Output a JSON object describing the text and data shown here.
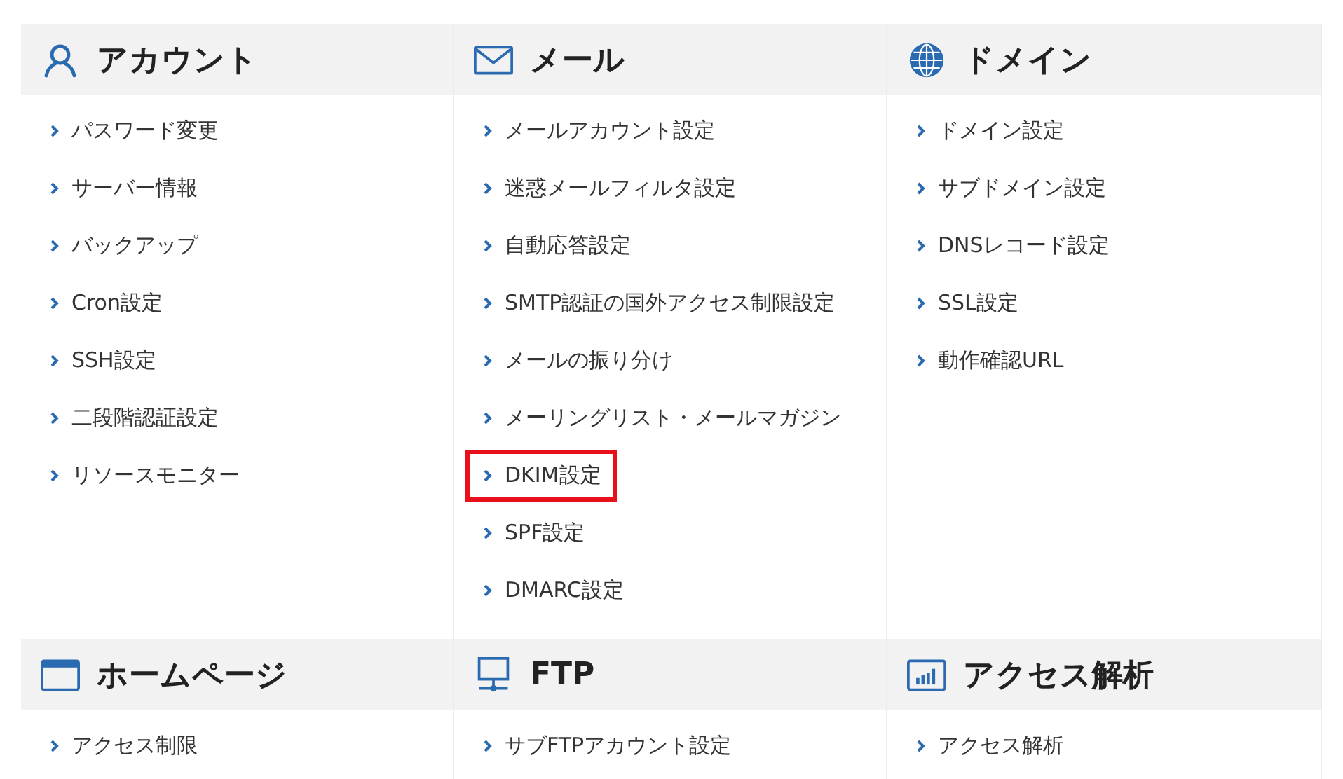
{
  "sections": [
    {
      "title": "アカウント",
      "items": [
        {
          "label": "パスワード変更",
          "highlighted": false
        },
        {
          "label": "サーバー情報",
          "highlighted": false
        },
        {
          "label": "バックアップ",
          "highlighted": false
        },
        {
          "label": "Cron設定",
          "highlighted": false
        },
        {
          "label": "SSH設定",
          "highlighted": false
        },
        {
          "label": "二段階認証設定",
          "highlighted": false
        },
        {
          "label": "リソースモニター",
          "highlighted": false
        }
      ]
    },
    {
      "title": "メール",
      "items": [
        {
          "label": "メールアカウント設定",
          "highlighted": false
        },
        {
          "label": "迷惑メールフィルタ設定",
          "highlighted": false
        },
        {
          "label": "自動応答設定",
          "highlighted": false
        },
        {
          "label": "SMTP認証の国外アクセス制限設定",
          "highlighted": false
        },
        {
          "label": "メールの振り分け",
          "highlighted": false
        },
        {
          "label": "メーリングリスト・メールマガジン",
          "highlighted": false
        },
        {
          "label": "DKIM設定",
          "highlighted": true
        },
        {
          "label": "SPF設定",
          "highlighted": false
        },
        {
          "label": "DMARC設定",
          "highlighted": false
        }
      ]
    },
    {
      "title": "ドメイン",
      "items": [
        {
          "label": "ドメイン設定",
          "highlighted": false
        },
        {
          "label": "サブドメイン設定",
          "highlighted": false
        },
        {
          "label": "DNSレコード設定",
          "highlighted": false
        },
        {
          "label": "SSL設定",
          "highlighted": false
        },
        {
          "label": "動作確認URL",
          "highlighted": false
        }
      ]
    },
    {
      "title": "ホームページ",
      "items": [
        {
          "label": "アクセス制限",
          "highlighted": false
        }
      ]
    },
    {
      "title": "FTP",
      "items": [
        {
          "label": "サブFTPアカウント設定",
          "highlighted": false
        }
      ]
    },
    {
      "title": "アクセス解析",
      "items": [
        {
          "label": "アクセス解析",
          "highlighted": false
        }
      ]
    }
  ]
}
